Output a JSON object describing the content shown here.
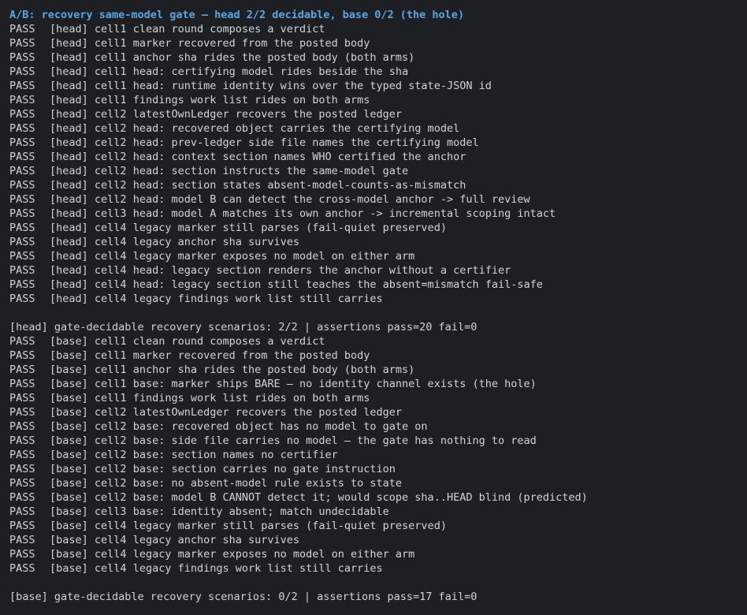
{
  "title": "A/B: recovery same-model gate — head 2/2 decidable, base 0/2 (the hole)",
  "head": {
    "rows": [
      {
        "status": "PASS",
        "arm": "[head]",
        "msg": "cell1 clean round composes a verdict"
      },
      {
        "status": "PASS",
        "arm": "[head]",
        "msg": "cell1 marker recovered from the posted body"
      },
      {
        "status": "PASS",
        "arm": "[head]",
        "msg": "cell1 anchor sha rides the posted body (both arms)"
      },
      {
        "status": "PASS",
        "arm": "[head]",
        "msg": "cell1 head: certifying model rides beside the sha"
      },
      {
        "status": "PASS",
        "arm": "[head]",
        "msg": "cell1 head: runtime identity wins over the typed state-JSON id"
      },
      {
        "status": "PASS",
        "arm": "[head]",
        "msg": "cell1 findings work list rides on both arms"
      },
      {
        "status": "PASS",
        "arm": "[head]",
        "msg": "cell2 latestOwnLedger recovers the posted ledger"
      },
      {
        "status": "PASS",
        "arm": "[head]",
        "msg": "cell2 head: recovered object carries the certifying model"
      },
      {
        "status": "PASS",
        "arm": "[head]",
        "msg": "cell2 head: prev-ledger side file names the certifying model"
      },
      {
        "status": "PASS",
        "arm": "[head]",
        "msg": "cell2 head: context section names WHO certified the anchor"
      },
      {
        "status": "PASS",
        "arm": "[head]",
        "msg": "cell2 head: section instructs the same-model gate"
      },
      {
        "status": "PASS",
        "arm": "[head]",
        "msg": "cell2 head: section states absent-model-counts-as-mismatch"
      },
      {
        "status": "PASS",
        "arm": "[head]",
        "msg": "cell2 head: model B can detect the cross-model anchor -> full review"
      },
      {
        "status": "PASS",
        "arm": "[head]",
        "msg": "cell3 head: model A matches its own anchor -> incremental scoping intact"
      },
      {
        "status": "PASS",
        "arm": "[head]",
        "msg": "cell4 legacy marker still parses (fail-quiet preserved)"
      },
      {
        "status": "PASS",
        "arm": "[head]",
        "msg": "cell4 legacy anchor sha survives"
      },
      {
        "status": "PASS",
        "arm": "[head]",
        "msg": "cell4 legacy marker exposes no model on either arm"
      },
      {
        "status": "PASS",
        "arm": "[head]",
        "msg": "cell4 head: legacy section renders the anchor without a certifier"
      },
      {
        "status": "PASS",
        "arm": "[head]",
        "msg": "cell4 head: legacy section still teaches the absent=mismatch fail-safe"
      },
      {
        "status": "PASS",
        "arm": "[head]",
        "msg": "cell4 legacy findings work list still carries"
      }
    ],
    "summary": "[head] gate-decidable recovery scenarios: 2/2 | assertions pass=20 fail=0"
  },
  "base": {
    "rows": [
      {
        "status": "PASS",
        "arm": "[base]",
        "msg": "cell1 clean round composes a verdict"
      },
      {
        "status": "PASS",
        "arm": "[base]",
        "msg": "cell1 marker recovered from the posted body"
      },
      {
        "status": "PASS",
        "arm": "[base]",
        "msg": "cell1 anchor sha rides the posted body (both arms)"
      },
      {
        "status": "PASS",
        "arm": "[base]",
        "msg": "cell1 base: marker ships BARE — no identity channel exists (the hole)"
      },
      {
        "status": "PASS",
        "arm": "[base]",
        "msg": "cell1 findings work list rides on both arms"
      },
      {
        "status": "PASS",
        "arm": "[base]",
        "msg": "cell2 latestOwnLedger recovers the posted ledger"
      },
      {
        "status": "PASS",
        "arm": "[base]",
        "msg": "cell2 base: recovered object has no model to gate on"
      },
      {
        "status": "PASS",
        "arm": "[base]",
        "msg": "cell2 base: side file carries no model — the gate has nothing to read"
      },
      {
        "status": "PASS",
        "arm": "[base]",
        "msg": "cell2 base: section names no certifier"
      },
      {
        "status": "PASS",
        "arm": "[base]",
        "msg": "cell2 base: section carries no gate instruction"
      },
      {
        "status": "PASS",
        "arm": "[base]",
        "msg": "cell2 base: no absent-model rule exists to state"
      },
      {
        "status": "PASS",
        "arm": "[base]",
        "msg": "cell2 base: model B CANNOT detect it; would scope sha..HEAD blind (predicted)"
      },
      {
        "status": "PASS",
        "arm": "[base]",
        "msg": "cell3 base: identity absent; match undecidable"
      },
      {
        "status": "PASS",
        "arm": "[base]",
        "msg": "cell4 legacy marker still parses (fail-quiet preserved)"
      },
      {
        "status": "PASS",
        "arm": "[base]",
        "msg": "cell4 legacy anchor sha survives"
      },
      {
        "status": "PASS",
        "arm": "[base]",
        "msg": "cell4 legacy marker exposes no model on either arm"
      },
      {
        "status": "PASS",
        "arm": "[base]",
        "msg": "cell4 legacy findings work list still carries"
      }
    ],
    "summary": "[base] gate-decidable recovery scenarios: 0/2 | assertions pass=17 fail=0"
  },
  "colors": {
    "background": "#1e1f22",
    "heading": "#5aa7e6",
    "text": "#d4d4d4"
  }
}
